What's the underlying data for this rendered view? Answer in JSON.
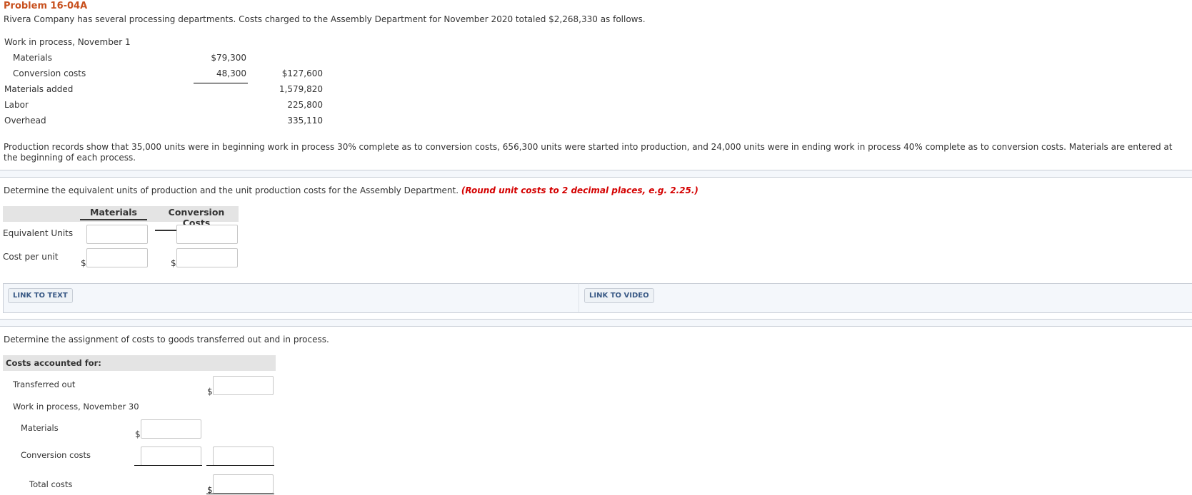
{
  "problem": {
    "title": "Problem 16-04A",
    "intro": "Rivera Company has several processing departments. Costs charged to the Assembly Department for November 2020 totaled $2,268,330 as follows."
  },
  "cost_table": {
    "wip_label": "Work in process, November 1",
    "rows": [
      {
        "label": "Materials",
        "col1": "$79,300",
        "col2": ""
      },
      {
        "label": "Conversion costs",
        "col1": "48,300",
        "col2": "$127,600"
      },
      {
        "label": "Materials added",
        "col1": "",
        "col2": "1,579,820"
      },
      {
        "label": "Labor",
        "col1": "",
        "col2": "225,800"
      },
      {
        "label": "Overhead",
        "col1": "",
        "col2": "335,110"
      }
    ]
  },
  "production_text": "Production records show that 35,000 units were in beginning work in process 30% complete as to conversion costs, 656,300 units were started into production, and 24,000 units were in ending work in process 40% complete as to conversion costs. Materials are entered at the beginning of each process.",
  "part1": {
    "instruction": "Determine the equivalent units of production and the unit production costs for the Assembly Department.",
    "hint": "(Round unit costs to 2 decimal places, e.g. 2.25.)",
    "headers": [
      "Materials",
      "Conversion Costs"
    ],
    "rows": [
      {
        "label": "Equivalent Units",
        "currency": "",
        "values": [
          "",
          ""
        ]
      },
      {
        "label": "Cost per unit",
        "currency": "$",
        "values": [
          "",
          ""
        ]
      }
    ]
  },
  "links": {
    "text": "LINK TO TEXT",
    "video": "LINK TO VIDEO"
  },
  "part2": {
    "instruction": "Determine the assignment of costs to goods transferred out and in process.",
    "section_header": "Costs accounted for:",
    "transferred_out": {
      "label": "Transferred out",
      "currency": "$",
      "value": ""
    },
    "wip_label": "Work in process, November 30",
    "materials": {
      "label": "Materials",
      "currency": "$",
      "value": ""
    },
    "conversion": {
      "label": "Conversion costs",
      "value": "",
      "subtotal": ""
    },
    "total": {
      "label": "Total costs",
      "currency": "$",
      "value": ""
    }
  }
}
